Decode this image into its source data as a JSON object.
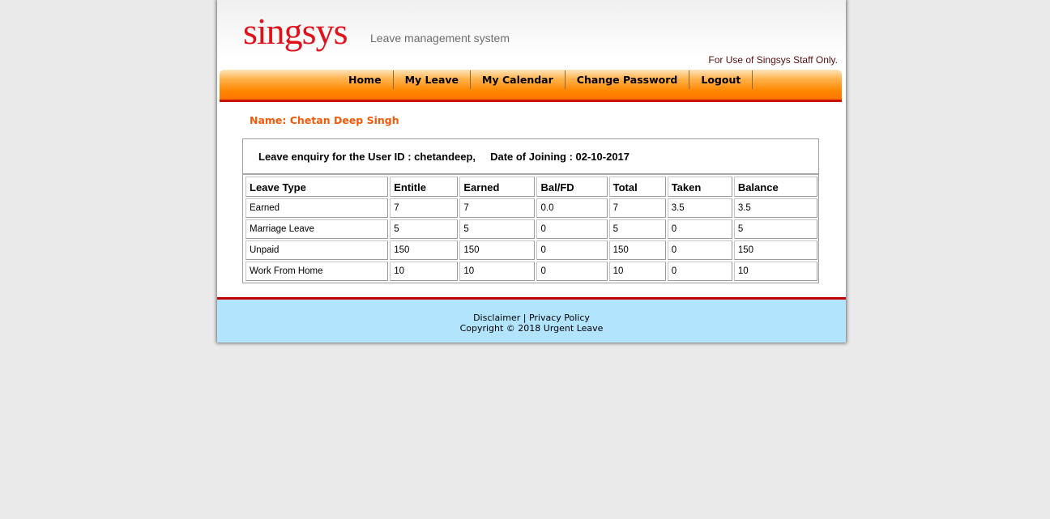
{
  "header": {
    "logo_text": "singsys",
    "tagline": "Leave management system",
    "staff_notice": "For Use of Singsys Staff Only."
  },
  "nav": {
    "items": [
      {
        "label": "Home"
      },
      {
        "label": "My Leave"
      },
      {
        "label": "My Calendar"
      },
      {
        "label": "Change Password"
      },
      {
        "label": "Logout"
      }
    ]
  },
  "user": {
    "name_line": "Name: Chetan Deep Singh"
  },
  "enquiry": {
    "header_text": "Leave enquiry for the User ID : chetandeep,     Date of Joining : 02-10-2017"
  },
  "table": {
    "columns": [
      "Leave Type",
      "Entitle",
      "Earned",
      "Bal/FD",
      "Total",
      "Taken",
      "Balance"
    ],
    "rows": [
      [
        "Earned",
        "7",
        "7",
        "0.0",
        "7",
        "3.5",
        "3.5"
      ],
      [
        "Marriage Leave",
        "5",
        "5",
        "0",
        "5",
        "0",
        "5"
      ],
      [
        "Unpaid",
        "150",
        "150",
        "0",
        "150",
        "0",
        "150"
      ],
      [
        "Work From Home",
        "10",
        "10",
        "0",
        "10",
        "0",
        "10"
      ]
    ]
  },
  "footer": {
    "disclaimer": "Disclaimer",
    "separator": " | ",
    "privacy": "Privacy Policy",
    "copyright": "Copyright © 2018 Urgent Leave"
  },
  "colors": {
    "brand_red": "#e1111b",
    "accent_orange": "#f25a0a",
    "footer_bg": "#b2e4fd"
  }
}
